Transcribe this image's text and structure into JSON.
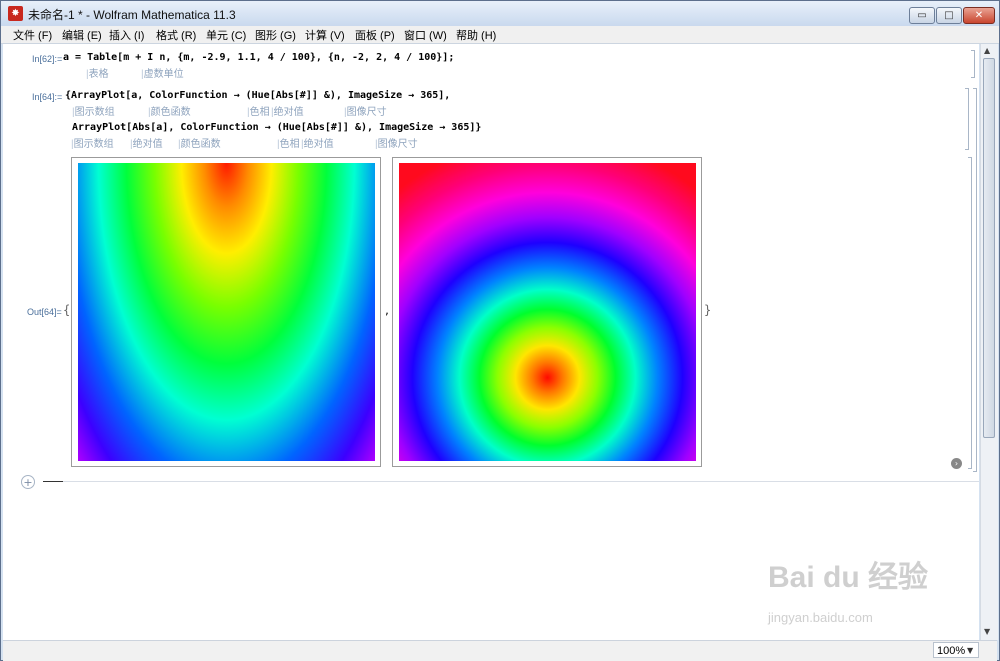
{
  "window": {
    "title": "未命名-1 * - Wolfram Mathematica 11.3",
    "app_icon": "mathematica-logo-icon",
    "controls": {
      "minimize": "▭",
      "maximize": "□",
      "close": "✕"
    }
  },
  "menu": [
    "文件 (F)",
    "编辑 (E)",
    "插入 (I)",
    "格式 (R)",
    "单元 (C)",
    "图形 (G)",
    "计算 (V)",
    "面板 (P)",
    "窗口 (W)",
    "帮助 (H)"
  ],
  "cells": {
    "in62": {
      "label": "In[62]:=",
      "code": "a = Table[m + I n, {m, -2.9, 1.1, 4 / 100}, {n, -2, 2, 4 / 100}];",
      "tips": [
        "表格",
        "虚数单位"
      ]
    },
    "in64": {
      "label": "In[64]:=",
      "line1": "{ArrayPlot[a, ColorFunction → (Hue[Abs[#]] &), ImageSize → 365],",
      "tips1": [
        "图示数组",
        "颜色函数",
        "色相",
        "绝对值",
        "图像尺寸"
      ],
      "line2": "ArrayPlot[Abs[a], ColorFunction → (Hue[Abs[#]] &), ImageSize → 365]}",
      "tips2": [
        "图示数组",
        "绝对值",
        "颜色函数",
        "色相",
        "绝对值",
        "图像尺寸"
      ]
    },
    "out64": {
      "label": "Out[64]=",
      "open_brace": "{",
      "comma": ",",
      "close_brace": "}"
    }
  },
  "status": {
    "zoom": "100%"
  },
  "watermark": {
    "line1": "Bai du 经验",
    "line2": "jingyan.baidu.com"
  }
}
